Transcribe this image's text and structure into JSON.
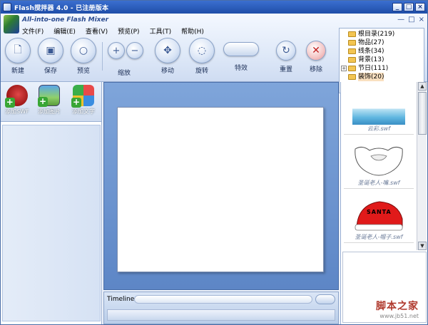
{
  "window": {
    "title": "Flash搅拌器 4.0 - 已注册版本"
  },
  "app": {
    "subtitle": "All-into-one Flash Mixer"
  },
  "menu": [
    "文件(F)",
    "编辑(E)",
    "查看(V)",
    "预览(P)",
    "工具(T)",
    "帮助(H)"
  ],
  "toolbar": {
    "new": "新建",
    "save": "保存",
    "preview": "预览",
    "zoom": "缩放",
    "move": "移动",
    "rotate": "旋转",
    "effects": "特效",
    "reset": "重置",
    "remove": "移除"
  },
  "tree": [
    {
      "label": "根目录(219)",
      "level": 0,
      "expander": ""
    },
    {
      "label": "物品(27)",
      "level": 1,
      "expander": ""
    },
    {
      "label": "线条(34)",
      "level": 1,
      "expander": ""
    },
    {
      "label": "背景(13)",
      "level": 1,
      "expander": ""
    },
    {
      "label": "节日(111)",
      "level": 1,
      "expander": "+"
    },
    {
      "label": "装饰(20)",
      "level": 1,
      "expander": "",
      "selected": true
    }
  ],
  "add_buttons": {
    "swf": "添加SWF",
    "image": "添加图片",
    "text": "添加文字"
  },
  "timeline": {
    "label": "Timeline"
  },
  "thumbnails": [
    {
      "caption": "云彩.swf"
    },
    {
      "caption": "圣诞老人-嘴.swf"
    },
    {
      "caption": "圣诞老人-帽子.swf"
    }
  ],
  "hat_text": "SANTA",
  "watermark": {
    "line1": "脚本之家",
    "line2": "www.jb51.net"
  },
  "colors": {
    "titlebar": "#2557b8",
    "stage": "#6b93cf",
    "accent": "#c01f1f"
  }
}
